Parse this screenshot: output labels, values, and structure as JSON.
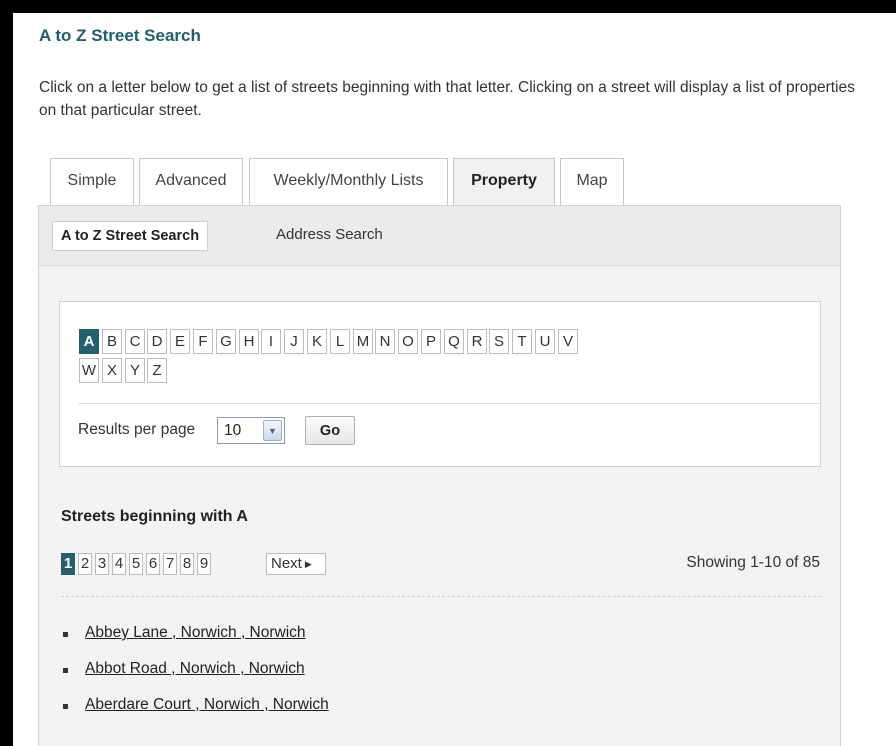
{
  "page": {
    "title": "A to Z Street Search",
    "intro": "Click on a letter below to get a list of streets beginning with that letter. Clicking on a street will display a list of properties on that particular street."
  },
  "tabs": [
    {
      "label": "Simple",
      "active": false
    },
    {
      "label": "Advanced",
      "active": false
    },
    {
      "label": "Weekly/Monthly Lists",
      "active": false
    },
    {
      "label": "Property",
      "active": true
    },
    {
      "label": "Map",
      "active": false
    }
  ],
  "subtabs": {
    "a_to_z": "A to Z Street Search",
    "address": "Address Search"
  },
  "letters": [
    "A",
    "B",
    "C",
    "D",
    "E",
    "F",
    "G",
    "H",
    "I",
    "J",
    "K",
    "L",
    "M",
    "N",
    "O",
    "P",
    "Q",
    "R",
    "S",
    "T",
    "U",
    "V",
    "W",
    "X",
    "Y",
    "Z"
  ],
  "active_letter": "A",
  "results_per_page": {
    "label": "Results per page",
    "value": "10"
  },
  "go_label": "Go",
  "results": {
    "heading": "Streets beginning with A",
    "pages": [
      "1",
      "2",
      "3",
      "4",
      "5",
      "6",
      "7",
      "8",
      "9"
    ],
    "active_page": "1",
    "next_label": "Next",
    "showing": "Showing 1-10 of 85",
    "streets": [
      "Abbey Lane , Norwich , Norwich",
      "Abbot Road , Norwich , Norwich",
      "Aberdare Court , Norwich , Norwich"
    ]
  },
  "colors": {
    "accent": "#23606e",
    "title": "#1f5f6e"
  }
}
